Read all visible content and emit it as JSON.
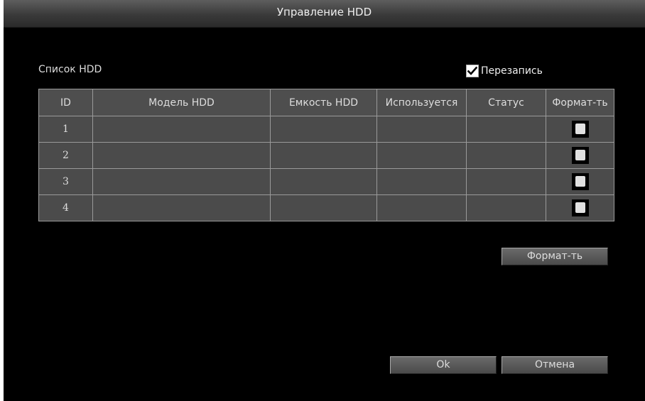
{
  "window": {
    "title": "Управление HDD"
  },
  "hdd_list": {
    "label": "Список HDD",
    "overwrite_label": "Перезапись",
    "overwrite_checked": true,
    "columns": [
      "ID",
      "Модель HDD",
      "Емкость HDD",
      "Используется",
      "Статус",
      "Формат-ть"
    ],
    "rows": [
      {
        "id": "1",
        "model": "",
        "capacity": "",
        "used": "",
        "status": "",
        "format_checked": false
      },
      {
        "id": "2",
        "model": "",
        "capacity": "",
        "used": "",
        "status": "",
        "format_checked": false
      },
      {
        "id": "3",
        "model": "",
        "capacity": "",
        "used": "",
        "status": "",
        "format_checked": false
      },
      {
        "id": "4",
        "model": "",
        "capacity": "",
        "used": "",
        "status": "",
        "format_checked": false
      }
    ]
  },
  "buttons": {
    "format": "Формат-ть",
    "ok": "Ok",
    "cancel": "Отмена"
  }
}
